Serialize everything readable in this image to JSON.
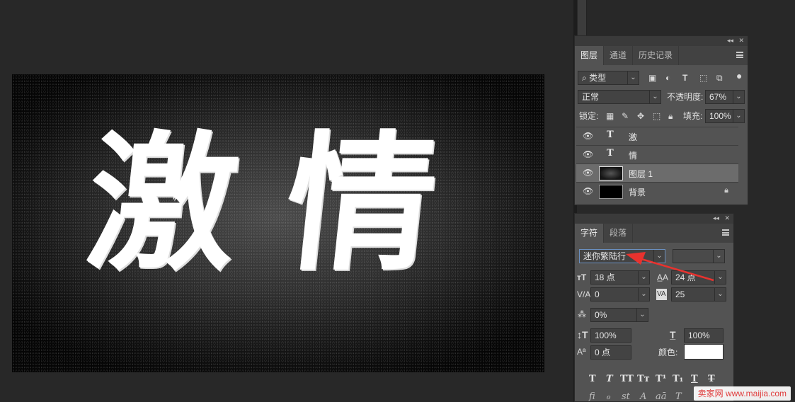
{
  "document": {
    "art_text": "激情"
  },
  "layers_panel": {
    "tabs": [
      "图层",
      "通道",
      "历史记录"
    ],
    "filter_kind": "类型",
    "blend_mode": "正常",
    "opacity_label": "不透明度:",
    "opacity_value": "67%",
    "lock_label": "锁定:",
    "fill_label": "填充:",
    "fill_value": "100%",
    "layers": [
      {
        "name": "激",
        "kind": "text"
      },
      {
        "name": "情",
        "kind": "text"
      },
      {
        "name": "图层 1",
        "kind": "image",
        "selected": true
      },
      {
        "name": "背景",
        "kind": "background",
        "locked": true
      }
    ],
    "icons": [
      "eye-icon",
      "type-layer-icon",
      "lock-icon"
    ]
  },
  "character_panel": {
    "tabs": [
      "字符",
      "段落"
    ],
    "font_family": "迷你繁陆行",
    "font_size": "18 点",
    "leading": "24 点",
    "kerning": "0",
    "tracking": "25",
    "tsume": "0%",
    "vertical_scale": "100%",
    "horizontal_scale": "100%",
    "baseline_shift": "0 点",
    "color_label": "颜色:",
    "text_color": "#ffffff",
    "faux_styles": [
      "T",
      "T",
      "TT",
      "Tт",
      "T¹",
      "T₁",
      "T",
      "T"
    ],
    "opentype": [
      "fi",
      "ℴ",
      "st",
      "A",
      "aā",
      "T"
    ]
  },
  "watermark": {
    "brand": "卖家网",
    "url": "www.maijia.com"
  },
  "colors": {
    "canvas_bg": "#282828",
    "panel_bg": "#535353",
    "selected_row": "#6c6c6c",
    "annotation_arrow": "#e8322e"
  }
}
